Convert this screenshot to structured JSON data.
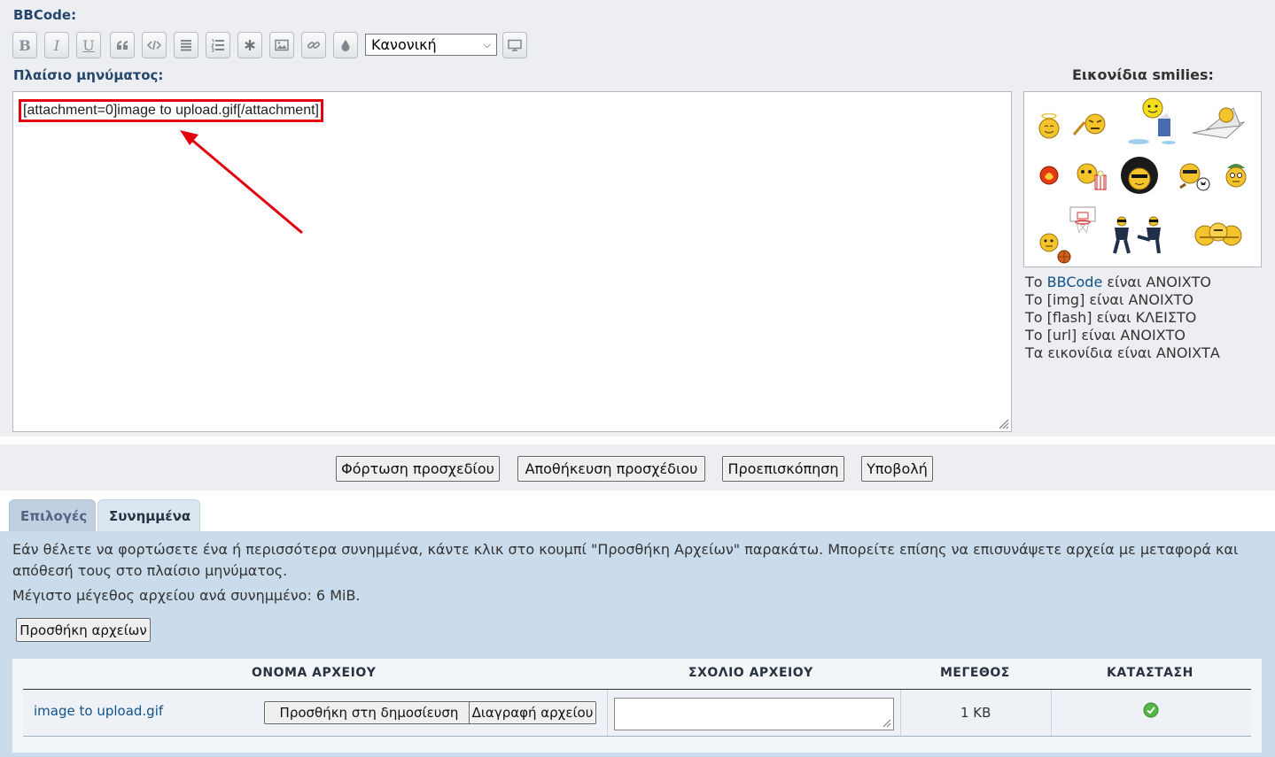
{
  "editor": {
    "bbcode_label": "BBCode:",
    "toolbar": [
      {
        "name": "bold-button",
        "glyph": "B"
      },
      {
        "name": "italic-button",
        "glyph": "I"
      },
      {
        "name": "underline-button",
        "glyph": "U"
      },
      {
        "name": "quote-button",
        "glyph": "quote-icon"
      },
      {
        "name": "code-button",
        "glyph": "code-icon"
      },
      {
        "name": "list-button",
        "glyph": "list-icon"
      },
      {
        "name": "ordered-list-button",
        "glyph": "ordered-list-icon"
      },
      {
        "name": "list-item-button",
        "glyph": "asterisk-icon"
      },
      {
        "name": "image-button",
        "glyph": "image-icon"
      },
      {
        "name": "link-button",
        "glyph": "link-icon"
      },
      {
        "name": "color-button",
        "glyph": "droplet-icon"
      }
    ],
    "font_size_select": "Κανονική",
    "message_label": "Πλαίσιο μηνύματος:",
    "message_text": "[attachment=0]image to upload.gif[/attachment]"
  },
  "smilies": {
    "label": "Εικονίδια smilies:"
  },
  "status": {
    "bbcode_prefix": "Το ",
    "bbcode_link": "BBCode",
    "bbcode_suffix": " είναι ΑΝΟΙΧΤΟ",
    "img": "Το [img] είναι ΑΝΟΙΧΤΟ",
    "flash": "Το [flash] είναι ΚΛΕΙΣΤΟ",
    "url": "Το [url] είναι ΑΝΟΙΧΤΟ",
    "smilies": "Τα εικονίδια είναι ΑΝΟΙΧΤΑ"
  },
  "actions": {
    "load_draft": "Φόρτωση προσχεδίου",
    "save_draft": "Αποθήκευση προσχέδιου",
    "preview": "Προεπισκόπηση",
    "submit": "Υποβολή"
  },
  "tabs": [
    {
      "label": "Επιλογές"
    },
    {
      "label": "Συνημμένα"
    }
  ],
  "attachments": {
    "info": "Εάν θέλετε να φορτώσετε ένα ή περισσότερα συνημμένα, κάντε κλικ στο κουμπί \"Προσθήκη Αρχείων\" παρακάτω. Μπορείτε επίσης να επισυνάψετε αρχεία με μεταφορά και απόθεσή τους στο πλαίσιο μηνύματος.",
    "max_size": "Μέγιστο μέγεθος αρχείου ανά συνημμένο: 6 MiB.",
    "add_files_button": "Προσθήκη αρχείων",
    "columns": [
      "ΟΝΟΜΑ ΑΡΧΕΙΟΥ",
      "ΣΧΟΛΙΟ ΑΡΧΕΙΟΥ",
      "ΜΕΓΕΘΟΣ",
      "ΚΑΤΑΣΤΑΣΗ"
    ],
    "files": [
      {
        "name": "image to upload.gif",
        "place_inline": "Προσθήκη στη δημοσίευση",
        "delete": "Διαγραφή αρχείου",
        "comment": "",
        "size": "1 KB",
        "status_icon": "check-circle-icon"
      }
    ]
  },
  "colors": {
    "panel_bg": "#eceef1",
    "attach_bg": "#cadceb",
    "heading": "#24466b",
    "link": "#105289",
    "highlight": "#e3000f",
    "ok": "#55b647"
  }
}
